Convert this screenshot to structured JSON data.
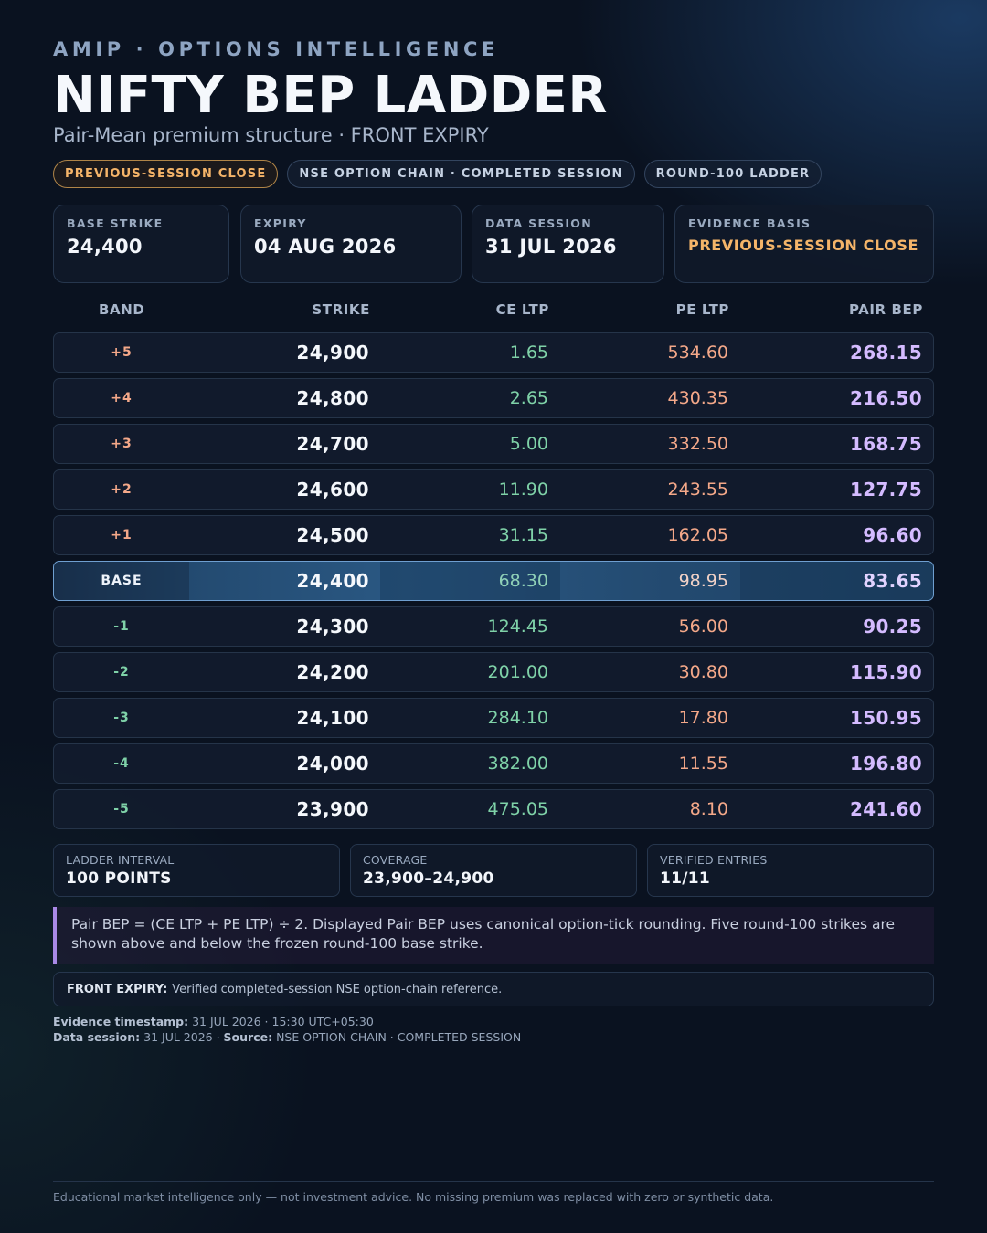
{
  "header": {
    "eyebrow": "AMIP · OPTIONS INTELLIGENCE",
    "title": "NIFTY BEP LADDER",
    "subtitle": "Pair-Mean premium structure · FRONT EXPIRY"
  },
  "chips": [
    "PREVIOUS-SESSION CLOSE",
    "NSE OPTION CHAIN · COMPLETED SESSION",
    "ROUND-100 LADDER"
  ],
  "info_cards": {
    "base_strike": {
      "label": "BASE STRIKE",
      "value": "24,400"
    },
    "expiry": {
      "label": "EXPIRY",
      "value": "04 AUG 2026"
    },
    "data_session": {
      "label": "DATA SESSION",
      "value": "31 JUL 2026"
    },
    "evidence_basis": {
      "label": "EVIDENCE BASIS",
      "value": "PREVIOUS-SESSION CLOSE"
    }
  },
  "table": {
    "headers": {
      "band": "BAND",
      "strike": "STRIKE",
      "ce": "CE LTP",
      "pe": "PE LTP",
      "bep": "PAIR BEP"
    },
    "rows": [
      {
        "band": "+5",
        "strike": "24,900",
        "ce": "1.65",
        "pe": "534.60",
        "bep": "268.15"
      },
      {
        "band": "+4",
        "strike": "24,800",
        "ce": "2.65",
        "pe": "430.35",
        "bep": "216.50"
      },
      {
        "band": "+3",
        "strike": "24,700",
        "ce": "5.00",
        "pe": "332.50",
        "bep": "168.75"
      },
      {
        "band": "+2",
        "strike": "24,600",
        "ce": "11.90",
        "pe": "243.55",
        "bep": "127.75"
      },
      {
        "band": "+1",
        "strike": "24,500",
        "ce": "31.15",
        "pe": "162.05",
        "bep": "96.60"
      },
      {
        "band": "BASE",
        "strike": "24,400",
        "ce": "68.30",
        "pe": "98.95",
        "bep": "83.65"
      },
      {
        "band": "-1",
        "strike": "24,300",
        "ce": "124.45",
        "pe": "56.00",
        "bep": "90.25"
      },
      {
        "band": "-2",
        "strike": "24,200",
        "ce": "201.00",
        "pe": "30.80",
        "bep": "115.90"
      },
      {
        "band": "-3",
        "strike": "24,100",
        "ce": "284.10",
        "pe": "17.80",
        "bep": "150.95"
      },
      {
        "band": "-4",
        "strike": "24,000",
        "ce": "382.00",
        "pe": "11.55",
        "bep": "196.80"
      },
      {
        "band": "-5",
        "strike": "23,900",
        "ce": "475.05",
        "pe": "8.10",
        "bep": "241.60"
      }
    ]
  },
  "stats": {
    "interval": {
      "label": "LADDER INTERVAL",
      "value": "100 POINTS"
    },
    "coverage": {
      "label": "COVERAGE",
      "value": "23,900–24,900"
    },
    "verified": {
      "label": "VERIFIED ENTRIES",
      "value": "11/11"
    }
  },
  "formula": "Pair BEP = (CE LTP + PE LTP) ÷ 2. Displayed Pair BEP uses canonical option-tick rounding. Five round-100 strikes are shown above and below the frozen round-100 base strike.",
  "note": {
    "label": "FRONT EXPIRY:",
    "text": "Verified completed-session NSE option-chain reference."
  },
  "meta": {
    "timestamp_label": "Evidence timestamp:",
    "timestamp_value": "31 JUL 2026 · 15:30 UTC+05:30",
    "session_label": "Data session:",
    "session_value": "31 JUL 2026 ·",
    "source_label": "Source:",
    "source_value": "NSE OPTION CHAIN · COMPLETED SESSION"
  },
  "footer": "Educational market intelligence only — not investment advice. No missing premium was replaced with zero or synthetic data.",
  "colors": {
    "background": "#0a1220",
    "accent_amber": "#f4b469",
    "ce_green": "#7fd2a8",
    "pe_salmon": "#f4a889",
    "bep_lavender": "#d4bbff",
    "base_row_blue": "#2a5883"
  }
}
